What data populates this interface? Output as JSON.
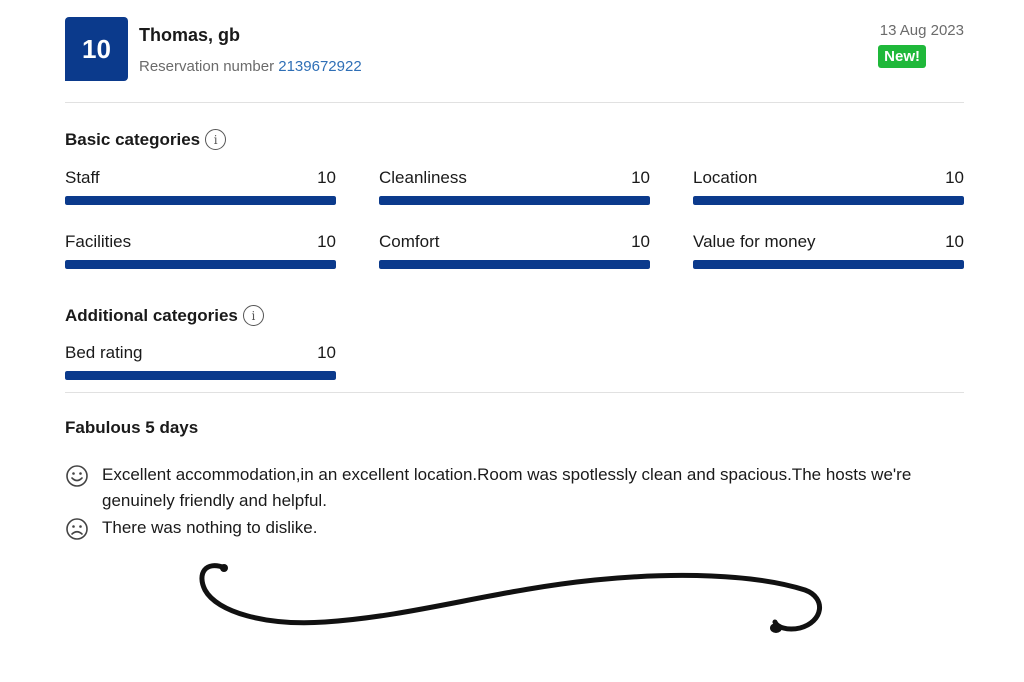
{
  "review": {
    "score": "10",
    "guest_name": "Thomas, gb",
    "reservation_label": "Reservation number",
    "reservation_number": "2139672922",
    "date": "13 Aug 2023",
    "badge": "New!",
    "title": "Fabulous 5 days",
    "positive": "Excellent accommodation,in an excellent location.Room was spotlessly clean and spacious.The hosts we're genuinely friendly and helpful.",
    "negative": "There was nothing to dislike."
  },
  "basic": {
    "title": "Basic categories",
    "info_icon": "info-icon",
    "items": [
      {
        "label": "Staff",
        "score": "10",
        "fraction": 1.0
      },
      {
        "label": "Cleanliness",
        "score": "10",
        "fraction": 1.0
      },
      {
        "label": "Location",
        "score": "10",
        "fraction": 1.0
      },
      {
        "label": "Facilities",
        "score": "10",
        "fraction": 1.0
      },
      {
        "label": "Comfort",
        "score": "10",
        "fraction": 1.0
      },
      {
        "label": "Value for money",
        "score": "10",
        "fraction": 1.0
      }
    ]
  },
  "additional": {
    "title": "Additional categories",
    "info_icon": "info-icon",
    "items": [
      {
        "label": "Bed rating",
        "score": "10",
        "fraction": 1.0
      }
    ]
  },
  "colors": {
    "brand": "#0b3a8c",
    "badge": "#1fb83a",
    "link": "#2f6fb6"
  },
  "icons": {
    "positive": "smiley-face-icon",
    "negative": "sad-face-icon"
  }
}
